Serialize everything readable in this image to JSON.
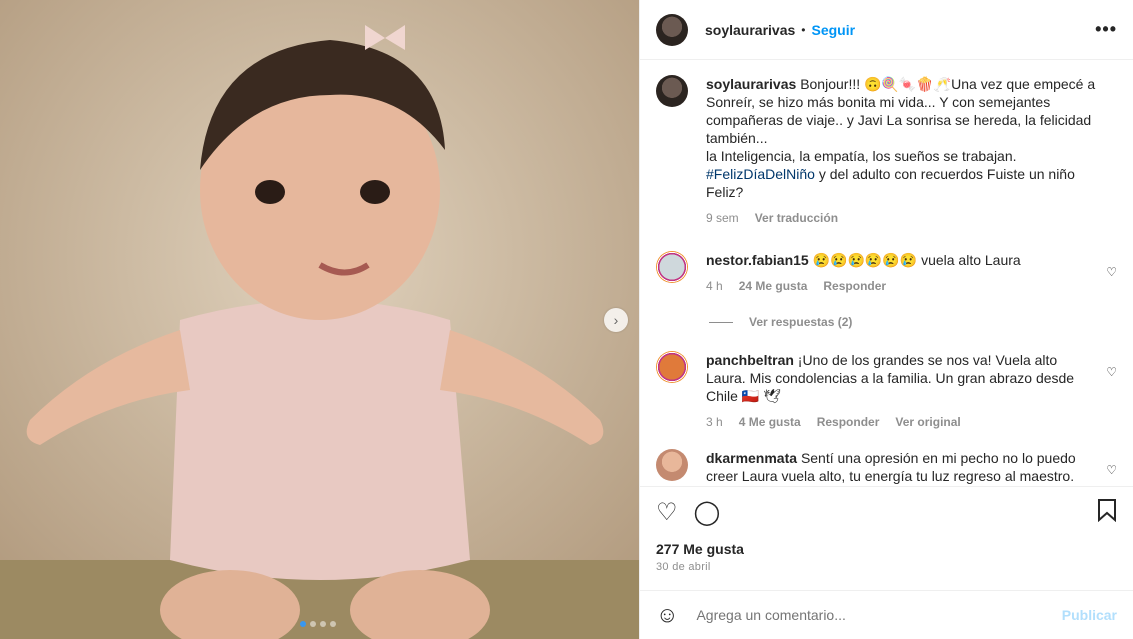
{
  "post": {
    "username": "soylaurarivas",
    "follow_label": "Seguir",
    "separator": "•",
    "more_icon": "•••"
  },
  "caption": {
    "username": "soylaurarivas",
    "text_1": "Bonjour!!! 🙃🍭🍬🍿🥂Una vez que empecé a Sonreír, se hizo más bonita mi vida... Y con semejantes compañeras de viaje.. y Javi La sonrisa se hereda, la felicidad también...",
    "text_2": "la Inteligencia, la empatía, los sueños se trabajan.",
    "hashtag": "#FelizDíaDelNiño",
    "text_3": " y del adulto con recuerdos Fuiste un niño Feliz?",
    "time": "9 sem",
    "translate_label": "Ver traducción"
  },
  "comments": [
    {
      "username": "nestor.fabian15",
      "text": "😢😢😢😢😢😢 vuela alto Laura",
      "time": "4 h",
      "likes": "24 Me gusta",
      "reply": "Responder",
      "extra": ""
    },
    {
      "username": "panchbeltran",
      "text": "¡Uno de los grandes se nos va! Vuela alto Laura. Mis condolencias a la familia. Un gran abrazo desde Chile 🇨🇱 🕊",
      "time": "3 h",
      "likes": "4 Me gusta",
      "reply": "Responder",
      "extra": "Ver original"
    },
    {
      "username": "dkarmenmata",
      "text": "Sentí una opresión en mi pecho no lo puedo creer Laura vuela alto, tu energía tu luz regreso al maestro.",
      "time": "",
      "likes": "",
      "reply": "",
      "extra": ""
    }
  ],
  "view_replies": "Ver respuestas (2)",
  "likes_count": "277 Me gusta",
  "date": "30 de abril",
  "add_comment": {
    "placeholder": "Agrega un comentario...",
    "post_label": "Publicar"
  },
  "icons": {
    "heart": "heart-icon",
    "comment": "comment-icon",
    "save": "bookmark-icon",
    "emoji": "emoji-icon",
    "next": "chevron-right-icon"
  },
  "colors": {
    "accent": "#0095f6",
    "hashtag": "#00376b",
    "muted": "#8e8e8e"
  }
}
